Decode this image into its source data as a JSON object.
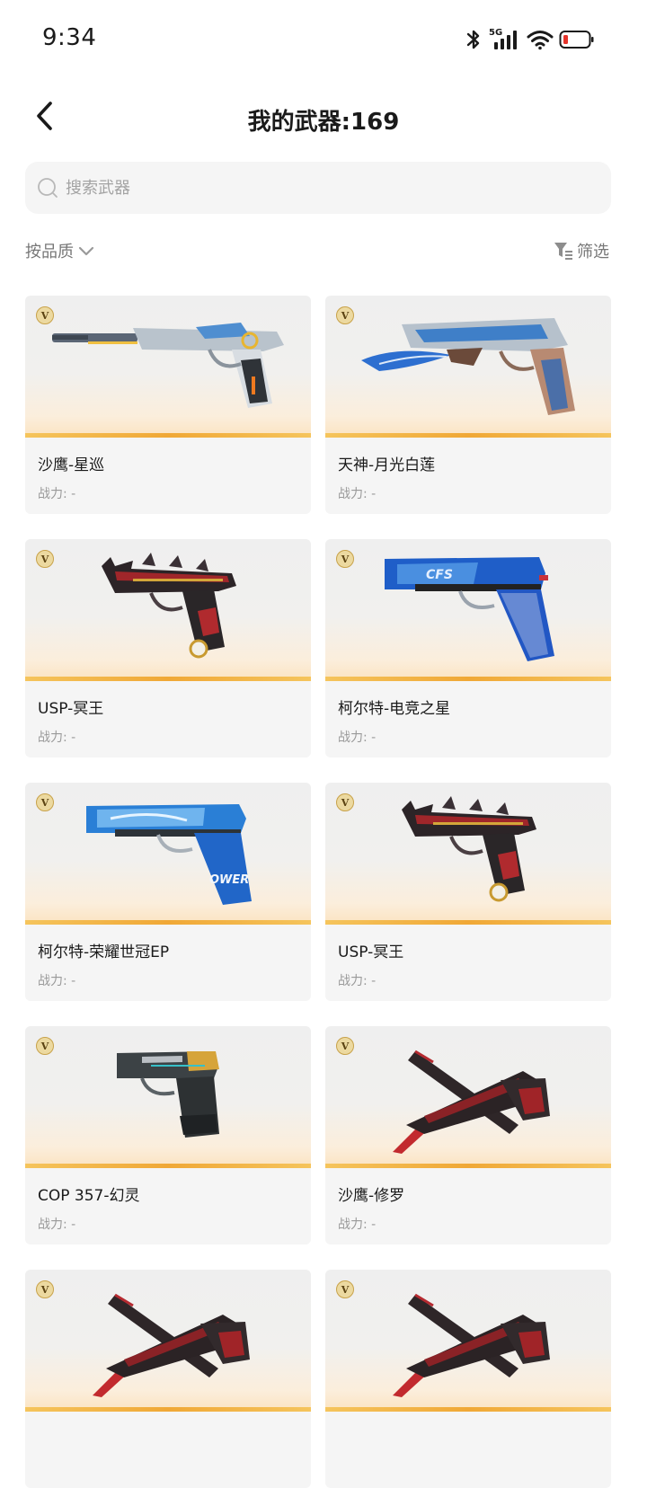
{
  "status_bar": {
    "time": "9:34",
    "network": "5G",
    "icons": [
      "bluetooth-icon",
      "signal-icon",
      "wifi-icon",
      "battery-low-icon"
    ]
  },
  "header": {
    "title": "我的武器:169",
    "back_icon": "chevron-left-icon"
  },
  "search": {
    "placeholder": "搜索武器",
    "value": ""
  },
  "sort": {
    "label": "按品质"
  },
  "filter": {
    "label": "筛选"
  },
  "colors": {
    "badge": "#ecd9a0",
    "rarity_bar": "#f0a836",
    "card_bg": "#f5f5f5",
    "muted_text": "#9a9a9a"
  },
  "weapons": [
    {
      "name": "沙鹰-星巡",
      "power": "战力: -",
      "badge": "V",
      "art": "desert-eagle-blue-silver"
    },
    {
      "name": "天神-月光白莲",
      "power": "战力: -",
      "badge": "V",
      "art": "desert-eagle-blue-blade"
    },
    {
      "name": "USP-冥王",
      "power": "战力: -",
      "badge": "V",
      "art": "pistol-dark-red-spiked"
    },
    {
      "name": "柯尔特-电竞之星",
      "power": "战力: -",
      "badge": "V",
      "art": "colt-blue-cfs"
    },
    {
      "name": "柯尔特-荣耀世冠EP",
      "power": "战力: -",
      "badge": "V",
      "art": "colt-blue-power"
    },
    {
      "name": "USP-冥王",
      "power": "战力: -",
      "badge": "V",
      "art": "pistol-dark-red-spiked"
    },
    {
      "name": "COP 357-幻灵",
      "power": "战力: -",
      "badge": "V",
      "art": "cop357-dark-gold"
    },
    {
      "name": "沙鹰-修罗",
      "power": "战力: -",
      "badge": "V",
      "art": "desert-eagle-crossed-blade"
    },
    {
      "name": "",
      "power": "",
      "badge": "V",
      "art": "desert-eagle-crossed-blade"
    },
    {
      "name": "",
      "power": "",
      "badge": "V",
      "art": "desert-eagle-crossed-blade"
    }
  ]
}
